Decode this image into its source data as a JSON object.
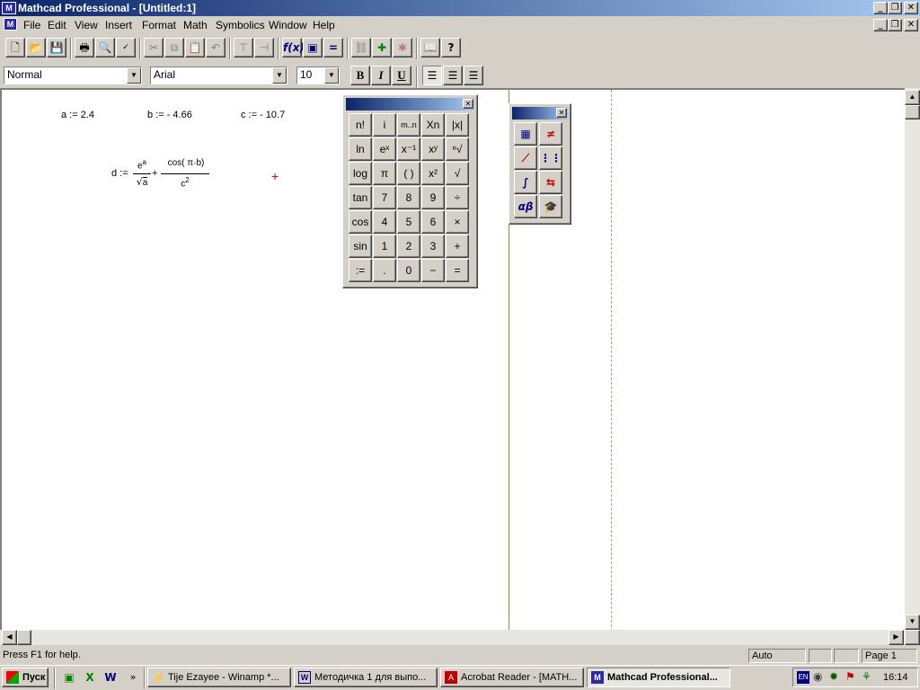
{
  "window": {
    "title": "Mathcad Professional - [Untitled:1]"
  },
  "menu": [
    "File",
    "Edit",
    "View",
    "Insert",
    "Format",
    "Math",
    "Symbolics",
    "Window",
    "Help"
  ],
  "format_bar": {
    "style": "Normal",
    "font": "Arial",
    "size": "10",
    "bold": "B",
    "italic": "I",
    "underline": "U"
  },
  "worksheet": {
    "a_def": "a := 2.4",
    "b_def": "b := - 4.66",
    "c_def": "c := - 10.7",
    "d_lhs": "d :=",
    "d_num1": "e",
    "d_num1_sup": "a",
    "d_den1": "a",
    "d_plus": "+",
    "d_num2": "cos( π·b)",
    "d_den2": "c",
    "d_den2_sup": "2",
    "cursor": "+"
  },
  "calculator": {
    "keys": [
      [
        "n!",
        "i",
        "m..n",
        "Xn",
        "|x|"
      ],
      [
        "ln",
        "eˣ",
        "x⁻¹",
        "xʸ",
        "ⁿ√"
      ],
      [
        "log",
        "π",
        "( )",
        "x²",
        "√"
      ],
      [
        "tan",
        "7",
        "8",
        "9",
        "÷"
      ],
      [
        "cos",
        "4",
        "5",
        "6",
        "×"
      ],
      [
        "sin",
        "1",
        "2",
        "3",
        "+"
      ],
      [
        ":=",
        ".",
        "0",
        "−",
        "="
      ]
    ]
  },
  "math_toolbar": {
    "greek": "αβ"
  },
  "status": {
    "help": "Press F1 for help.",
    "mode": "Auto",
    "page": "Page 1"
  },
  "taskbar": {
    "start": "Пуск",
    "tasks": [
      "Tije Ezayee - Winamp *...",
      "Методичка 1 для выпо...",
      "Acrobat Reader - [MATH...",
      "Mathcad Professional..."
    ],
    "lang": "EN",
    "clock": "16:14"
  }
}
